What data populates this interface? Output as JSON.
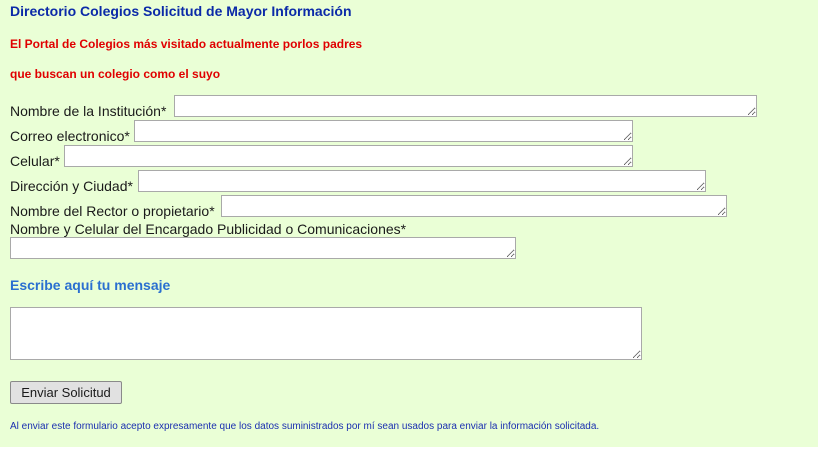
{
  "header": {
    "title": "Directorio Colegios Solicitud de Mayor Información",
    "tagline_line1": "El Portal de Colegios más visitado actualmente porlos padres",
    "tagline_line2": "que buscan un colegio como el suyo"
  },
  "form": {
    "fields": {
      "institucion": {
        "label": "Nombre de la Institución*",
        "value": ""
      },
      "correo": {
        "label": "Correo electronico*",
        "value": ""
      },
      "celular": {
        "label": "Celular*",
        "value": ""
      },
      "direccion": {
        "label": "Dirección y Ciudad*",
        "value": ""
      },
      "rector": {
        "label": "Nombre del Rector o propietario*",
        "value": ""
      },
      "encargado": {
        "label": "Nombre y Celular del Encargado Publicidad o Comunicaciones*",
        "value": ""
      }
    },
    "message": {
      "heading": "Escribe aquí tu mensaje",
      "value": ""
    },
    "submit_label": "Enviar Solicitud",
    "disclaimer": "Al enviar este formulario acepto expresamente que los datos suministrados por mí sean usados para enviar la información solicitada."
  },
  "colors": {
    "background": "#eaffd6",
    "title": "#0b2aa8",
    "tagline": "#e00000",
    "message_heading": "#2a6fd0",
    "disclaimer": "#1a2fb0"
  }
}
